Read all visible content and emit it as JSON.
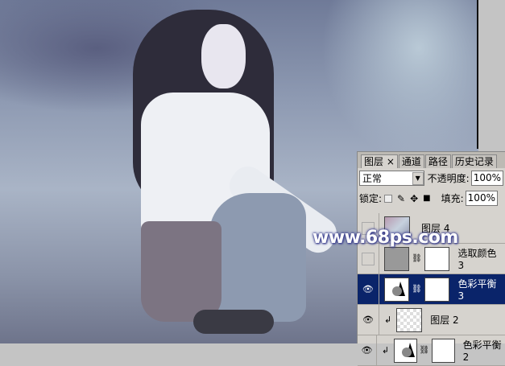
{
  "watermark": "www.68ps.com",
  "panel": {
    "tabs": [
      {
        "label": "图层 ×"
      },
      {
        "label": "通道"
      },
      {
        "label": "路径"
      },
      {
        "label": "历史记录"
      }
    ],
    "blend_mode": "正常",
    "opacity_label": "不透明度:",
    "opacity": "100%",
    "lock_label": "锁定:",
    "fill_label": "填充:",
    "fill": "100%",
    "layers": [
      {
        "name": "图层 4",
        "visible": false
      },
      {
        "name": "选取颜色 3",
        "visible": false
      },
      {
        "name": "色彩平衡 3",
        "visible": true,
        "selected": true
      },
      {
        "name": "图层 2",
        "visible": true
      },
      {
        "name": "色彩平衡 2",
        "visible": true
      }
    ]
  }
}
